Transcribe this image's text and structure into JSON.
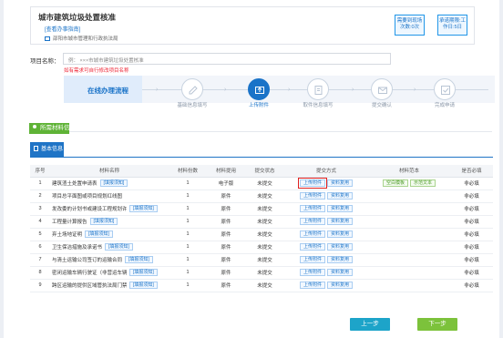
{
  "header": {
    "title": "城市建筑垃圾处置核准",
    "guide_link": "[查看办事指南]",
    "department": "邵阳市城市管理和行政执法局",
    "tags": [
      "需要到现场 次数:0次",
      "承诺期限:工 作日:5日"
    ]
  },
  "project": {
    "label": "项目名称：",
    "value": "例：      ×××市城市建筑垃圾处置核准",
    "hint": "如有需求可自行修改项目名称"
  },
  "steps": {
    "heading": "在线办理流程",
    "items": [
      {
        "label": "基础信息填写",
        "icon": "edit-icon",
        "active": false
      },
      {
        "label": "上传附件",
        "icon": "upload-icon",
        "active": true
      },
      {
        "label": "取件信息填写",
        "icon": "doc-edit-icon",
        "active": false
      },
      {
        "label": "提交确认",
        "icon": "mail-icon",
        "active": false
      },
      {
        "label": "完成申请",
        "icon": "check-icon",
        "active": false
      }
    ]
  },
  "materials": {
    "section_title": "所需材料信息",
    "basic_info_tab": "基本信息",
    "columns": [
      "序号",
      "材料名称",
      "材料份数",
      "材料提用",
      "提交状态",
      "提交方式",
      "材料范本",
      "是否必填"
    ],
    "link_label": "[填报须知]",
    "upload_label": "上传附件",
    "reuse_label": "资料复用",
    "empty_template_label": "空白模板",
    "sample_label": "示范文本",
    "rows": [
      {
        "no": "1",
        "name": "建筑渣土处置申请表",
        "tip": true,
        "copies": "1",
        "type": "电子版",
        "status": "未提交",
        "template": true,
        "required": "非必填"
      },
      {
        "no": "2",
        "name": "项目总平面图或项目规划红线图",
        "tip": false,
        "copies": "1",
        "type": "原件",
        "status": "未提交",
        "template": false,
        "required": "非必填"
      },
      {
        "no": "3",
        "name": "发改委的计划书或建设工程规划许...",
        "tip": true,
        "copies": "1",
        "type": "原件",
        "status": "未提交",
        "template": false,
        "required": "非必填"
      },
      {
        "no": "4",
        "name": "工程量计算报告",
        "tip": true,
        "copies": "1",
        "type": "原件",
        "status": "未提交",
        "template": false,
        "required": "非必填"
      },
      {
        "no": "5",
        "name": "弃土场地证明",
        "tip": true,
        "copies": "1",
        "type": "原件",
        "status": "未提交",
        "template": false,
        "required": "非必填"
      },
      {
        "no": "6",
        "name": "卫生保洁措施及承诺书",
        "tip": true,
        "copies": "1",
        "type": "原件",
        "status": "未提交",
        "template": false,
        "required": "非必填"
      },
      {
        "no": "7",
        "name": "与清土运输公司签订的运输合同",
        "tip": true,
        "copies": "1",
        "type": "原件",
        "status": "未提交",
        "template": false,
        "required": "非必填"
      },
      {
        "no": "8",
        "name": "密闭运输车辆行驶证（非营运车辆）或道路运输证（营运车辆）",
        "tip": true,
        "copies": "1",
        "type": "原件",
        "status": "未提交",
        "template": false,
        "required": "非必填"
      },
      {
        "no": "9",
        "name": "跨区运输的提供区域管执法局门禁...",
        "tip": true,
        "copies": "1",
        "type": "原件",
        "status": "未提交",
        "template": false,
        "required": "非必填"
      }
    ]
  },
  "nav": {
    "prev": "上一步",
    "next": "下一步"
  },
  "colors": {
    "primary": "#1a73c8",
    "green": "#5fb336",
    "red": "#e03a2a"
  }
}
